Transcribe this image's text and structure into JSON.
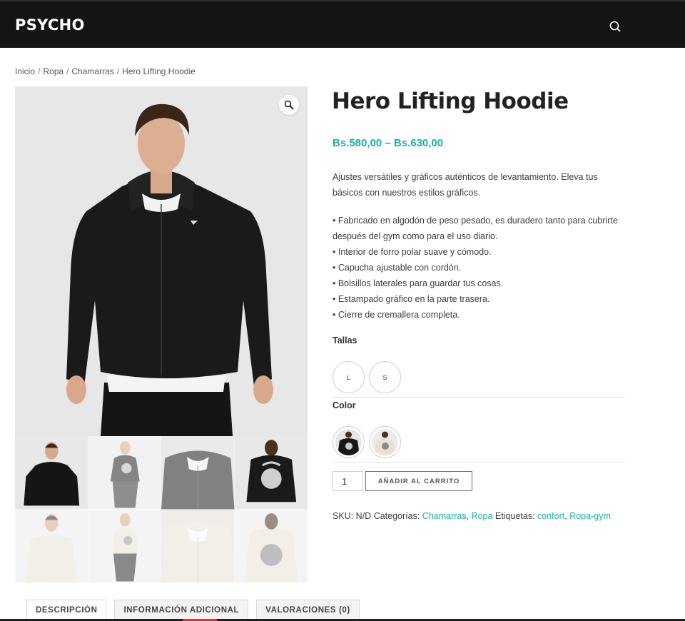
{
  "header": {
    "logo": "PSYCHO",
    "search_icon": "search-icon"
  },
  "breadcrumb": {
    "items": [
      "Inicio",
      "Ropa",
      "Chamarras",
      "Hero Lifting Hoodie"
    ],
    "separator": "/"
  },
  "gallery": {
    "zoom_icon": "magnifier-icon",
    "thumbnail_count": 8
  },
  "product": {
    "title": "Hero Lifting Hoodie",
    "price": "Bs.580,00 – Bs.630,00",
    "intro": "Ajustes versátiles y gráficos auténticos de levantamiento. Eleva tus básicos con nuestros estilos gráficos.",
    "features": [
      "• Fabricado en algodón de peso pesado, es duradero tanto para cubrirte después del gym como para el uso diario.",
      "• Interior de forro polar suave y cómodo.",
      "• Capucha ajustable con cordón.",
      "• Bolsillos laterales para guardar tus cosas.",
      "• Estampado gráfico en la parte trasera.",
      "• Cierre de cremallera completa."
    ],
    "sizes_label": "Tallas",
    "sizes": [
      "L",
      "S"
    ],
    "color_label": "Color",
    "colors": [
      "black",
      "cream"
    ],
    "quantity": "1",
    "add_to_cart": "AÑADIR AL CARRITO",
    "meta": {
      "sku_label": "SKU:",
      "sku": "N/D",
      "categories_label": "Categorías:",
      "categories": [
        "Chamarras",
        "Ropa"
      ],
      "tags_label": "Etiquetas:",
      "tags": [
        "confort",
        "Ropa-gym"
      ]
    }
  },
  "tabs": [
    "DESCRIPCIÓN",
    "INFORMACIÓN ADICIONAL",
    "VALORACIONES (0)"
  ],
  "colors": {
    "accent": "#1ab0a6",
    "header_bg": "#141414"
  }
}
